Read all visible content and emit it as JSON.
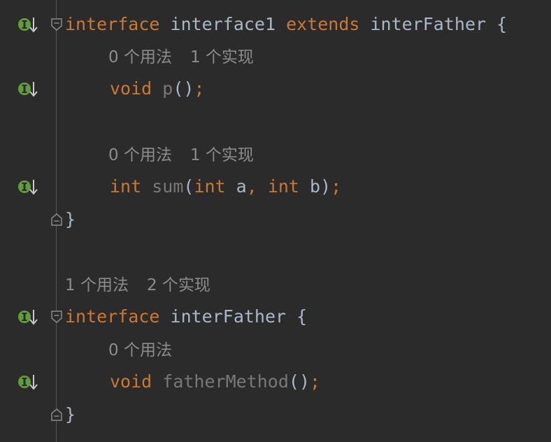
{
  "editor": {
    "lines": [
      {
        "type": "code",
        "tokens": [
          {
            "t": "interface",
            "c": "kw"
          },
          {
            "t": " interface1 ",
            "c": "ident"
          },
          {
            "t": "extends",
            "c": "kw"
          },
          {
            "t": " interFather {",
            "c": "ident"
          }
        ]
      },
      {
        "type": "hint",
        "items": [
          "0 个用法",
          "1 个实现"
        ]
      },
      {
        "type": "code",
        "tokens": [
          {
            "t": "void",
            "c": "kw"
          },
          {
            "t": " ",
            "c": "ident"
          },
          {
            "t": "p",
            "c": "unused"
          },
          {
            "t": "()",
            "c": "ident"
          },
          {
            "t": ";",
            "c": "punct"
          }
        ]
      },
      {
        "type": "hint",
        "items": [
          "0 个用法",
          "1 个实现"
        ]
      },
      {
        "type": "code",
        "tokens": [
          {
            "t": "int",
            "c": "kw"
          },
          {
            "t": " ",
            "c": "ident"
          },
          {
            "t": "sum",
            "c": "unused"
          },
          {
            "t": "(",
            "c": "ident"
          },
          {
            "t": "int",
            "c": "kw"
          },
          {
            "t": " a",
            "c": "ident"
          },
          {
            "t": ",",
            "c": "punct"
          },
          {
            "t": " ",
            "c": "ident"
          },
          {
            "t": "int",
            "c": "kw"
          },
          {
            "t": " b)",
            "c": "ident"
          },
          {
            "t": ";",
            "c": "punct"
          }
        ]
      },
      {
        "type": "code",
        "tokens": [
          {
            "t": "}",
            "c": "ident"
          }
        ]
      },
      {
        "type": "hint",
        "items": [
          "1 个用法",
          "2 个实现"
        ]
      },
      {
        "type": "code",
        "tokens": [
          {
            "t": "interface",
            "c": "kw"
          },
          {
            "t": " interFather {",
            "c": "ident"
          }
        ]
      },
      {
        "type": "hint",
        "items": [
          "0 个用法"
        ]
      },
      {
        "type": "code",
        "tokens": [
          {
            "t": "void",
            "c": "kw"
          },
          {
            "t": " ",
            "c": "ident"
          },
          {
            "t": "fatherMethod",
            "c": "unused"
          },
          {
            "t": "()",
            "c": "ident"
          },
          {
            "t": ";",
            "c": "punct"
          }
        ]
      },
      {
        "type": "code",
        "tokens": [
          {
            "t": "}",
            "c": "ident"
          }
        ]
      }
    ]
  },
  "icons": {
    "implemented": "implemented-gutter-icon",
    "fold_open": "fold-open-icon",
    "fold_close": "fold-close-icon"
  },
  "colors": {
    "background": "#2b2b2b",
    "keyword": "#cc7832",
    "identifier": "#a9b7c6",
    "unused": "#787878",
    "hint": "#8c8c8c",
    "gutter_icon": "#5f9e3a"
  }
}
